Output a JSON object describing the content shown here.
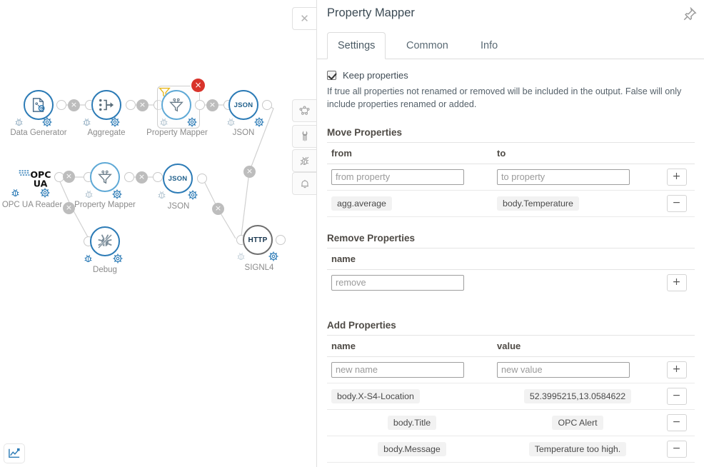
{
  "panel": {
    "title": "Property Mapper",
    "pin_icon": "pin-icon",
    "close_icon": "close-icon",
    "tabs": [
      {
        "label": "Settings",
        "active": true
      },
      {
        "label": "Common",
        "active": false
      },
      {
        "label": "Info",
        "active": false
      }
    ],
    "keep_properties": {
      "label": "Keep properties",
      "checked": true,
      "help": "If true all properties not renamed or removed will be included in the output. False will only include properties renamed or added."
    },
    "move_properties": {
      "title": "Move Properties",
      "headers": {
        "from": "from",
        "to": "to",
        "action": ""
      },
      "input_row": {
        "from_placeholder": "from property",
        "from_value": "",
        "to_placeholder": "to property",
        "to_value": "",
        "add_label": "+"
      },
      "rows": [
        {
          "from": "agg.average",
          "to": "body.Temperature",
          "remove_label": "−"
        }
      ]
    },
    "remove_properties": {
      "title": "Remove Properties",
      "headers": {
        "name": "name"
      },
      "input_row": {
        "name_placeholder": "remove",
        "name_value": "",
        "add_label": "+"
      },
      "rows": []
    },
    "add_properties": {
      "title": "Add Properties",
      "headers": {
        "name": "name",
        "value": "value"
      },
      "input_row": {
        "name_placeholder": "new name",
        "name_value": "",
        "value_placeholder": "new value",
        "value_value": "",
        "add_label": "+"
      },
      "rows": [
        {
          "name": "body.X-S4-Location",
          "value": "52.3995215,13.0584622",
          "remove_label": "−"
        },
        {
          "name": "body.Title",
          "value": "OPC Alert",
          "remove_label": "−"
        },
        {
          "name": "body.Message",
          "value": "Temperature too high.",
          "remove_label": "−"
        }
      ]
    }
  },
  "edge_tabs": [
    {
      "icon": "nodes-graph-icon",
      "name": "flow-tab"
    },
    {
      "icon": "wrench-icon",
      "name": "config-tab"
    },
    {
      "icon": "debug-bug-icon",
      "name": "debug-tab"
    },
    {
      "icon": "bell-icon",
      "name": "notifications-tab"
    }
  ],
  "chart_tab": {
    "icon": "chart-icon"
  },
  "canvas": {
    "nodes": [
      {
        "id": "data-generator",
        "label": "Data Generator",
        "icon": "document-gear-icon",
        "selected": false,
        "error": false,
        "style": "blue"
      },
      {
        "id": "aggregate",
        "label": "Aggregate",
        "icon": "aggregate-arrow-icon",
        "selected": false,
        "error": false,
        "style": "blue"
      },
      {
        "id": "property-mapper-1",
        "label": "Property Mapper",
        "icon": "funnel-icon",
        "selected": true,
        "error": true,
        "style": "light"
      },
      {
        "id": "json-1",
        "label": "JSON",
        "icon": "json-icon",
        "selected": false,
        "error": false,
        "style": "blue"
      },
      {
        "id": "opc-ua-reader",
        "label": "OPC UA Reader",
        "icon": "opc-ua-logo",
        "selected": false,
        "error": false,
        "style": "logo"
      },
      {
        "id": "property-mapper-2",
        "label": "Property Mapper",
        "icon": "funnel-icon",
        "selected": false,
        "error": false,
        "style": "light"
      },
      {
        "id": "json-2",
        "label": "JSON",
        "icon": "json-icon",
        "selected": false,
        "error": false,
        "style": "blue"
      },
      {
        "id": "debug",
        "label": "Debug",
        "icon": "debug-bug-icon",
        "selected": false,
        "error": false,
        "style": "blue"
      },
      {
        "id": "signl4",
        "label": "SIGNL4",
        "icon": "http-icon",
        "selected": false,
        "error": false,
        "style": "grey"
      }
    ],
    "node_badge_labels": {
      "delete": "×",
      "error": "×"
    }
  }
}
